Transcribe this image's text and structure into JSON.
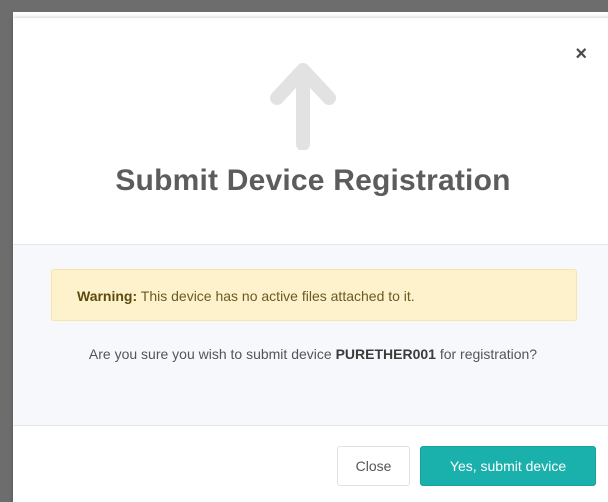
{
  "modal": {
    "title": "Submit Device Registration",
    "close_symbol": "×",
    "icon": "arrow-up-icon"
  },
  "warning": {
    "label": "Warning:",
    "message": " This device has no active files attached to it."
  },
  "confirm": {
    "prefix": "Are you sure you wish to submit device ",
    "device_id": "PURETHER001",
    "suffix": " for registration?"
  },
  "footer": {
    "close_label": "Close",
    "submit_label": "Yes, submit device"
  },
  "colors": {
    "primary": "#1ab0ac",
    "warning_bg": "#fdf2cc",
    "icon": "#e2e2e2",
    "title": "#5c5c5c"
  }
}
